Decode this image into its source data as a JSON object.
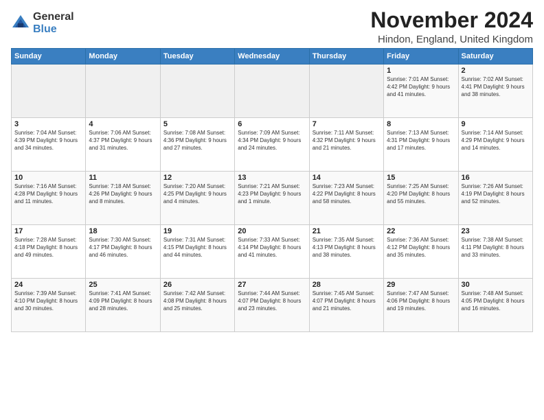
{
  "logo": {
    "general": "General",
    "blue": "Blue"
  },
  "title": "November 2024",
  "subtitle": "Hindon, England, United Kingdom",
  "headers": [
    "Sunday",
    "Monday",
    "Tuesday",
    "Wednesday",
    "Thursday",
    "Friday",
    "Saturday"
  ],
  "weeks": [
    [
      {
        "num": "",
        "info": ""
      },
      {
        "num": "",
        "info": ""
      },
      {
        "num": "",
        "info": ""
      },
      {
        "num": "",
        "info": ""
      },
      {
        "num": "",
        "info": ""
      },
      {
        "num": "1",
        "info": "Sunrise: 7:01 AM\nSunset: 4:42 PM\nDaylight: 9 hours\nand 41 minutes."
      },
      {
        "num": "2",
        "info": "Sunrise: 7:02 AM\nSunset: 4:41 PM\nDaylight: 9 hours\nand 38 minutes."
      }
    ],
    [
      {
        "num": "3",
        "info": "Sunrise: 7:04 AM\nSunset: 4:39 PM\nDaylight: 9 hours\nand 34 minutes."
      },
      {
        "num": "4",
        "info": "Sunrise: 7:06 AM\nSunset: 4:37 PM\nDaylight: 9 hours\nand 31 minutes."
      },
      {
        "num": "5",
        "info": "Sunrise: 7:08 AM\nSunset: 4:36 PM\nDaylight: 9 hours\nand 27 minutes."
      },
      {
        "num": "6",
        "info": "Sunrise: 7:09 AM\nSunset: 4:34 PM\nDaylight: 9 hours\nand 24 minutes."
      },
      {
        "num": "7",
        "info": "Sunrise: 7:11 AM\nSunset: 4:32 PM\nDaylight: 9 hours\nand 21 minutes."
      },
      {
        "num": "8",
        "info": "Sunrise: 7:13 AM\nSunset: 4:31 PM\nDaylight: 9 hours\nand 17 minutes."
      },
      {
        "num": "9",
        "info": "Sunrise: 7:14 AM\nSunset: 4:29 PM\nDaylight: 9 hours\nand 14 minutes."
      }
    ],
    [
      {
        "num": "10",
        "info": "Sunrise: 7:16 AM\nSunset: 4:28 PM\nDaylight: 9 hours\nand 11 minutes."
      },
      {
        "num": "11",
        "info": "Sunrise: 7:18 AM\nSunset: 4:26 PM\nDaylight: 9 hours\nand 8 minutes."
      },
      {
        "num": "12",
        "info": "Sunrise: 7:20 AM\nSunset: 4:25 PM\nDaylight: 9 hours\nand 4 minutes."
      },
      {
        "num": "13",
        "info": "Sunrise: 7:21 AM\nSunset: 4:23 PM\nDaylight: 9 hours\nand 1 minute."
      },
      {
        "num": "14",
        "info": "Sunrise: 7:23 AM\nSunset: 4:22 PM\nDaylight: 8 hours\nand 58 minutes."
      },
      {
        "num": "15",
        "info": "Sunrise: 7:25 AM\nSunset: 4:20 PM\nDaylight: 8 hours\nand 55 minutes."
      },
      {
        "num": "16",
        "info": "Sunrise: 7:26 AM\nSunset: 4:19 PM\nDaylight: 8 hours\nand 52 minutes."
      }
    ],
    [
      {
        "num": "17",
        "info": "Sunrise: 7:28 AM\nSunset: 4:18 PM\nDaylight: 8 hours\nand 49 minutes."
      },
      {
        "num": "18",
        "info": "Sunrise: 7:30 AM\nSunset: 4:17 PM\nDaylight: 8 hours\nand 46 minutes."
      },
      {
        "num": "19",
        "info": "Sunrise: 7:31 AM\nSunset: 4:15 PM\nDaylight: 8 hours\nand 44 minutes."
      },
      {
        "num": "20",
        "info": "Sunrise: 7:33 AM\nSunset: 4:14 PM\nDaylight: 8 hours\nand 41 minutes."
      },
      {
        "num": "21",
        "info": "Sunrise: 7:35 AM\nSunset: 4:13 PM\nDaylight: 8 hours\nand 38 minutes."
      },
      {
        "num": "22",
        "info": "Sunrise: 7:36 AM\nSunset: 4:12 PM\nDaylight: 8 hours\nand 35 minutes."
      },
      {
        "num": "23",
        "info": "Sunrise: 7:38 AM\nSunset: 4:11 PM\nDaylight: 8 hours\nand 33 minutes."
      }
    ],
    [
      {
        "num": "24",
        "info": "Sunrise: 7:39 AM\nSunset: 4:10 PM\nDaylight: 8 hours\nand 30 minutes."
      },
      {
        "num": "25",
        "info": "Sunrise: 7:41 AM\nSunset: 4:09 PM\nDaylight: 8 hours\nand 28 minutes."
      },
      {
        "num": "26",
        "info": "Sunrise: 7:42 AM\nSunset: 4:08 PM\nDaylight: 8 hours\nand 25 minutes."
      },
      {
        "num": "27",
        "info": "Sunrise: 7:44 AM\nSunset: 4:07 PM\nDaylight: 8 hours\nand 23 minutes."
      },
      {
        "num": "28",
        "info": "Sunrise: 7:45 AM\nSunset: 4:07 PM\nDaylight: 8 hours\nand 21 minutes."
      },
      {
        "num": "29",
        "info": "Sunrise: 7:47 AM\nSunset: 4:06 PM\nDaylight: 8 hours\nand 19 minutes."
      },
      {
        "num": "30",
        "info": "Sunrise: 7:48 AM\nSunset: 4:05 PM\nDaylight: 8 hours\nand 16 minutes."
      }
    ]
  ]
}
